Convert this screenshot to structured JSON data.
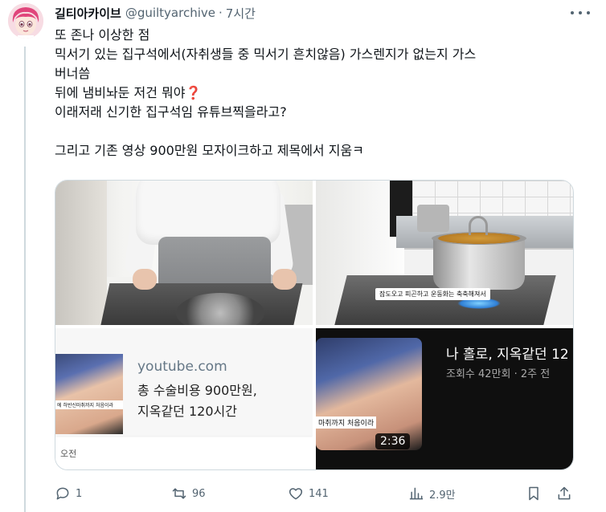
{
  "tweet": {
    "author_name": "길티아카이브",
    "handle": "@guiltyarchive",
    "separator": "·",
    "time": "7시간",
    "lines": [
      "또 존나 이상한 점",
      "믹서기 있는 집구석에서(자취생들 중 믹서기 흔치않음) 가스렌지가 없는지 가스",
      "버너씀",
      "뒤에 냄비놔둔 저건 뭐야",
      "이래저래 신기한 집구석임 유튜브찍을라고?",
      "",
      "그리고 기존 영상 900만원 모자이크하고 제목에서 지움ㅋ"
    ],
    "emoji": "❓"
  },
  "media": {
    "top_right_caption": "잠도오고 피곤하고 운동화는 축축해져서",
    "link_card": {
      "domain": "youtube.com",
      "title_line1": "총 수술비용 900만원,",
      "title_line2": "지옥같던 120시간",
      "thumb_caption": "에 하반신마취까지 처음이라",
      "time_label": "오전"
    },
    "video_card": {
      "title": "나 홀로, 지옥같던 12",
      "meta": "조회수 42만회 · 2주 전",
      "caption": "마취까지 처음이라",
      "duration": "2:36"
    }
  },
  "actions": {
    "reply_count": "1",
    "retweet_count": "96",
    "like_count": "141",
    "views_count": "2.9만"
  },
  "colors": {
    "muted": "#536471",
    "text": "#0f1419",
    "border": "#cfd9de",
    "emoji_red": "#be1931"
  }
}
